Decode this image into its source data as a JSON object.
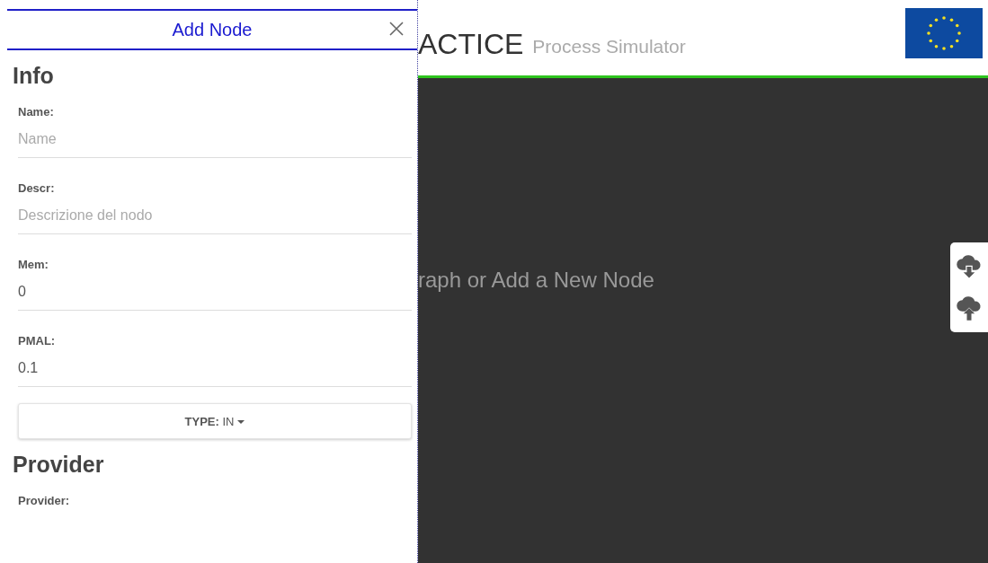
{
  "header": {
    "title": "ACTICE",
    "subtitle": "Process Simulator"
  },
  "canvas": {
    "message": "raph or Add a New Node"
  },
  "panel": {
    "title": "Add Node",
    "sections": [
      {
        "heading": "Info",
        "fields": [
          {
            "label": "Name:",
            "placeholder": "Name"
          },
          {
            "label": "Descr:",
            "placeholder": "Descrizione del nodo"
          },
          {
            "label": "Mem:",
            "value": "0"
          },
          {
            "label": "PMAL:",
            "value": "0.1"
          }
        ],
        "dropdown": {
          "label": "TYPE:",
          "value": "IN"
        }
      },
      {
        "heading": "Provider",
        "fields": [
          {
            "label": "Provider:"
          }
        ]
      }
    ]
  }
}
